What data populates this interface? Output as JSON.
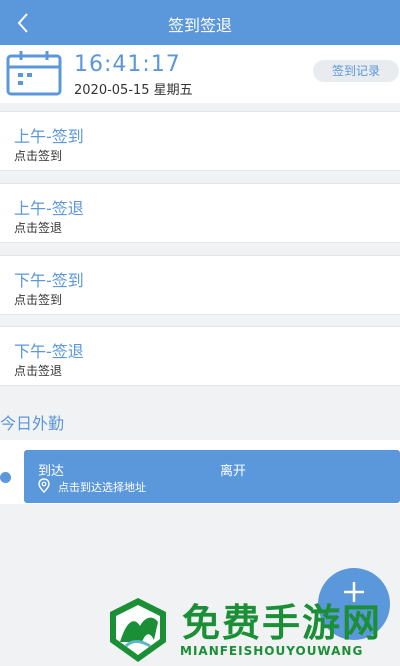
{
  "header": {
    "title": "签到签退",
    "back_icon": "chevron-left-icon"
  },
  "clock": {
    "time": "16:41:17",
    "date": "2020-05-15 星期五",
    "records_label": "签到记录",
    "calendar_icon": "calendar-icon"
  },
  "cards": [
    {
      "title": "上午-签到",
      "action": "点击签到"
    },
    {
      "title": "上午-签退",
      "action": "点击签退"
    },
    {
      "title": "下午-签到",
      "action": "点击签到"
    },
    {
      "title": "下午-签退",
      "action": "点击签退"
    }
  ],
  "fieldwork": {
    "section_title": "今日外勤",
    "arrive_label": "到达",
    "leave_label": "离开",
    "address_prompt": "点击到达选择地址",
    "pin_icon": "location-pin-icon"
  },
  "fab": {
    "icon": "plus-icon"
  },
  "watermark": {
    "text": "免费手游网",
    "subtext": "MIANFEISHOUYOUWANG"
  },
  "colors": {
    "accent": "#5b97db",
    "background": "#f1f2f4",
    "watermark": "#1a8f36"
  }
}
